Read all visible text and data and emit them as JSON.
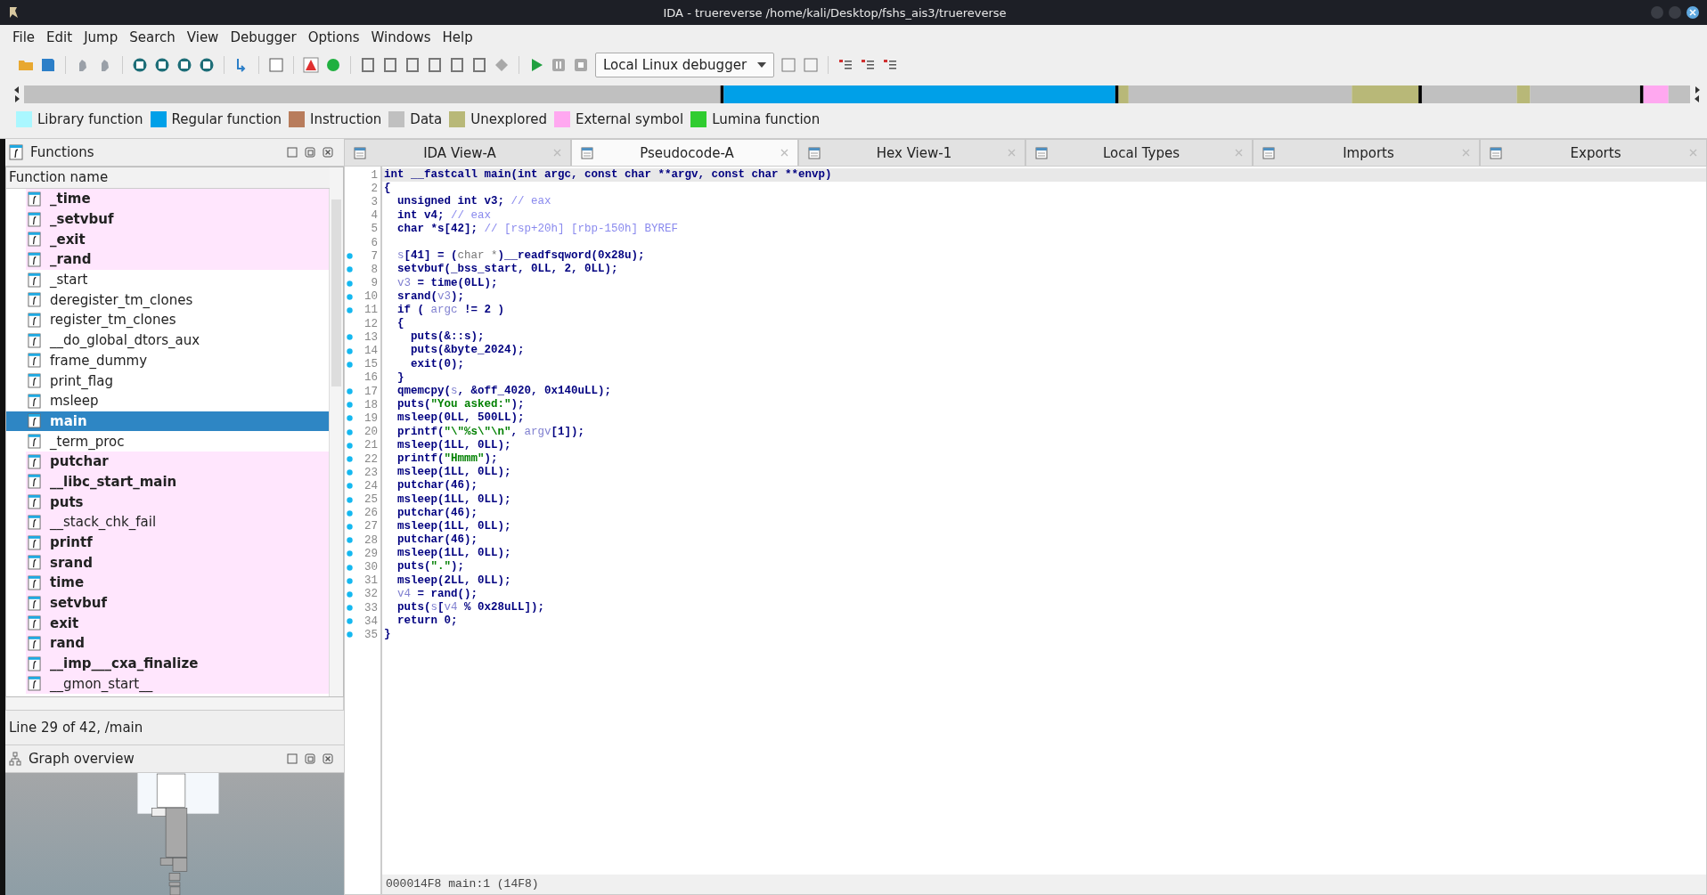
{
  "window": {
    "title": "IDA - truereverse /home/kali/Desktop/fshs_ais3/truereverse"
  },
  "menu": [
    "File",
    "Edit",
    "Jump",
    "Search",
    "View",
    "Debugger",
    "Options",
    "Windows",
    "Help"
  ],
  "toolbar": {
    "debugger": "Local Linux debugger"
  },
  "legend": [
    {
      "label": "Library function",
      "color": "#aaf7ff"
    },
    {
      "label": "Regular function",
      "color": "#00a0e8"
    },
    {
      "label": "Instruction",
      "color": "#b87c5c"
    },
    {
      "label": "Data",
      "color": "#c0c0c0"
    },
    {
      "label": "Unexplored",
      "color": "#b8b878"
    },
    {
      "label": "External symbol",
      "color": "#ffa8f0"
    },
    {
      "label": "Lumina function",
      "color": "#30cc30"
    }
  ],
  "functions": {
    "title": "Functions",
    "column": "Function name",
    "items": [
      {
        "name": "_time",
        "kind": "external",
        "selected": false
      },
      {
        "name": "_setvbuf",
        "kind": "external",
        "selected": false
      },
      {
        "name": "_exit",
        "kind": "external",
        "selected": false
      },
      {
        "name": "_rand",
        "kind": "external",
        "selected": false
      },
      {
        "name": "_start",
        "kind": "regular",
        "selected": false
      },
      {
        "name": "deregister_tm_clones",
        "kind": "regular",
        "selected": false
      },
      {
        "name": "register_tm_clones",
        "kind": "regular",
        "selected": false
      },
      {
        "name": "__do_global_dtors_aux",
        "kind": "regular",
        "selected": false
      },
      {
        "name": "frame_dummy",
        "kind": "regular",
        "selected": false
      },
      {
        "name": "print_flag",
        "kind": "regular",
        "selected": false
      },
      {
        "name": "msleep",
        "kind": "regular",
        "selected": false
      },
      {
        "name": "main",
        "kind": "regular",
        "selected": true
      },
      {
        "name": "_term_proc",
        "kind": "regular",
        "selected": false
      },
      {
        "name": "putchar",
        "kind": "external",
        "selected": false
      },
      {
        "name": "__libc_start_main",
        "kind": "external",
        "selected": false
      },
      {
        "name": "puts",
        "kind": "external",
        "selected": false
      },
      {
        "name": "__stack_chk_fail",
        "kind": "external_plain",
        "selected": false
      },
      {
        "name": "printf",
        "kind": "external",
        "selected": false
      },
      {
        "name": "srand",
        "kind": "external",
        "selected": false
      },
      {
        "name": "time",
        "kind": "external",
        "selected": false
      },
      {
        "name": "setvbuf",
        "kind": "external",
        "selected": false
      },
      {
        "name": "exit",
        "kind": "external",
        "selected": false
      },
      {
        "name": "rand",
        "kind": "external",
        "selected": false
      },
      {
        "name": "__imp___cxa_finalize",
        "kind": "external",
        "selected": false
      },
      {
        "name": "__gmon_start__",
        "kind": "external_plain",
        "selected": false
      }
    ]
  },
  "status": "Line 29 of 42, /main",
  "graph_overview": {
    "title": "Graph overview"
  },
  "tabs": [
    {
      "label": "IDA View-A",
      "selected": false
    },
    {
      "label": "Pseudocode-A",
      "selected": true
    },
    {
      "label": "Hex View-1",
      "selected": false
    },
    {
      "label": "Local Types",
      "selected": false
    },
    {
      "label": "Imports",
      "selected": false
    },
    {
      "label": "Exports",
      "selected": false
    }
  ],
  "code": [
    {
      "no": "1",
      "dot": false,
      "selected": true,
      "segs": [
        {
          "t": "int __fastcall main(int argc, const char **argv, const char **envp)",
          "kind": "n"
        }
      ]
    },
    {
      "no": "2",
      "dot": false,
      "selected": false,
      "segs": [
        {
          "t": "{",
          "kind": "n"
        }
      ]
    },
    {
      "no": "3",
      "dot": false,
      "selected": false,
      "segs": [
        {
          "t": "  unsigned int v3; ",
          "kind": "n"
        },
        {
          "t": "// eax",
          "kind": "c"
        }
      ]
    },
    {
      "no": "4",
      "dot": false,
      "selected": false,
      "segs": [
        {
          "t": "  int v4; ",
          "kind": "n"
        },
        {
          "t": "// eax",
          "kind": "c"
        }
      ]
    },
    {
      "no": "5",
      "dot": false,
      "selected": false,
      "segs": [
        {
          "t": "  char *s[42]; ",
          "kind": "n"
        },
        {
          "t": "// [rsp+20h] [rbp-150h] BYREF",
          "kind": "c"
        }
      ]
    },
    {
      "no": "6",
      "dot": false,
      "selected": false
    },
    {
      "no": "7",
      "dot": true,
      "selected": false,
      "segs": [
        {
          "t": "  s",
          "kind": "v"
        },
        {
          "t": "[41] = (",
          "kind": "n"
        },
        {
          "t": "char *",
          "kind": "g"
        },
        {
          "t": ")__readfsqword(0x28u);",
          "kind": "n"
        }
      ]
    },
    {
      "no": "8",
      "dot": true,
      "selected": false,
      "segs": [
        {
          "t": "  setvbuf(_bss_start, 0LL, 2, 0LL);",
          "kind": "n"
        }
      ]
    },
    {
      "no": "9",
      "dot": true,
      "selected": false,
      "segs": [
        {
          "t": "  v3",
          "kind": "v"
        },
        {
          "t": " = time(0LL);",
          "kind": "n"
        }
      ]
    },
    {
      "no": "10",
      "dot": true,
      "selected": false,
      "segs": [
        {
          "t": "  srand(",
          "kind": "n"
        },
        {
          "t": "v3",
          "kind": "v"
        },
        {
          "t": ");",
          "kind": "n"
        }
      ]
    },
    {
      "no": "11",
      "dot": true,
      "selected": false,
      "segs": [
        {
          "t": "  if ( ",
          "kind": "n"
        },
        {
          "t": "argc",
          "kind": "v"
        },
        {
          "t": " != 2 )",
          "kind": "n"
        }
      ]
    },
    {
      "no": "12",
      "dot": false,
      "selected": false,
      "segs": [
        {
          "t": "  {",
          "kind": "n"
        }
      ]
    },
    {
      "no": "13",
      "dot": true,
      "selected": false,
      "segs": [
        {
          "t": "    puts(&::s);",
          "kind": "n"
        }
      ]
    },
    {
      "no": "14",
      "dot": true,
      "selected": false,
      "segs": [
        {
          "t": "    puts(&byte_2024);",
          "kind": "n"
        }
      ]
    },
    {
      "no": "15",
      "dot": true,
      "selected": false,
      "segs": [
        {
          "t": "    exit(0);",
          "kind": "n"
        }
      ]
    },
    {
      "no": "16",
      "dot": false,
      "selected": false,
      "segs": [
        {
          "t": "  }",
          "kind": "n"
        }
      ]
    },
    {
      "no": "17",
      "dot": true,
      "selected": false,
      "segs": [
        {
          "t": "  qmemcpy(",
          "kind": "n"
        },
        {
          "t": "s",
          "kind": "v"
        },
        {
          "t": ", &off_4020, 0x140uLL);",
          "kind": "n"
        }
      ]
    },
    {
      "no": "18",
      "dot": true,
      "selected": false,
      "segs": [
        {
          "t": "  puts(",
          "kind": "n"
        },
        {
          "t": "\"You asked:\"",
          "kind": "s"
        },
        {
          "t": ");",
          "kind": "n"
        }
      ]
    },
    {
      "no": "19",
      "dot": true,
      "selected": false,
      "segs": [
        {
          "t": "  msleep(0LL, 500LL);",
          "kind": "n"
        }
      ]
    },
    {
      "no": "20",
      "dot": true,
      "selected": false,
      "segs": [
        {
          "t": "  printf(",
          "kind": "n"
        },
        {
          "t": "\"\\\"%s\\\"\\n\"",
          "kind": "s"
        },
        {
          "t": ", ",
          "kind": "n"
        },
        {
          "t": "argv",
          "kind": "v"
        },
        {
          "t": "[1]);",
          "kind": "n"
        }
      ]
    },
    {
      "no": "21",
      "dot": true,
      "selected": false,
      "segs": [
        {
          "t": "  msleep(1LL, 0LL);",
          "kind": "n"
        }
      ]
    },
    {
      "no": "22",
      "dot": true,
      "selected": false,
      "segs": [
        {
          "t": "  printf(",
          "kind": "n"
        },
        {
          "t": "\"Hmmm\"",
          "kind": "s"
        },
        {
          "t": ");",
          "kind": "n"
        }
      ]
    },
    {
      "no": "23",
      "dot": true,
      "selected": false,
      "segs": [
        {
          "t": "  msleep(1LL, 0LL);",
          "kind": "n"
        }
      ]
    },
    {
      "no": "24",
      "dot": true,
      "selected": false,
      "segs": [
        {
          "t": "  putchar(46);",
          "kind": "n"
        }
      ]
    },
    {
      "no": "25",
      "dot": true,
      "selected": false,
      "segs": [
        {
          "t": "  msleep(1LL, 0LL);",
          "kind": "n"
        }
      ]
    },
    {
      "no": "26",
      "dot": true,
      "selected": false,
      "segs": [
        {
          "t": "  putchar(46);",
          "kind": "n"
        }
      ]
    },
    {
      "no": "27",
      "dot": true,
      "selected": false,
      "segs": [
        {
          "t": "  msleep(1LL, 0LL);",
          "kind": "n"
        }
      ]
    },
    {
      "no": "28",
      "dot": true,
      "selected": false,
      "segs": [
        {
          "t": "  putchar(46);",
          "kind": "n"
        }
      ]
    },
    {
      "no": "29",
      "dot": true,
      "selected": false,
      "segs": [
        {
          "t": "  msleep(1LL, 0LL);",
          "kind": "n"
        }
      ]
    },
    {
      "no": "30",
      "dot": true,
      "selected": false,
      "segs": [
        {
          "t": "  puts(",
          "kind": "n"
        },
        {
          "t": "\".\"",
          "kind": "s"
        },
        {
          "t": ");",
          "kind": "n"
        }
      ]
    },
    {
      "no": "31",
      "dot": true,
      "selected": false,
      "segs": [
        {
          "t": "  msleep(2LL, 0LL);",
          "kind": "n"
        }
      ]
    },
    {
      "no": "32",
      "dot": true,
      "selected": false,
      "segs": [
        {
          "t": "  v4",
          "kind": "v"
        },
        {
          "t": " = rand();",
          "kind": "n"
        }
      ]
    },
    {
      "no": "33",
      "dot": true,
      "selected": false,
      "segs": [
        {
          "t": "  puts(",
          "kind": "n"
        },
        {
          "t": "s",
          "kind": "v"
        },
        {
          "t": "[",
          "kind": "n"
        },
        {
          "t": "v4",
          "kind": "v"
        },
        {
          "t": " % 0x28uLL]);",
          "kind": "n"
        }
      ]
    },
    {
      "no": "34",
      "dot": true,
      "selected": false,
      "segs": [
        {
          "t": "  return 0;",
          "kind": "n"
        }
      ]
    },
    {
      "no": "35",
      "dot": true,
      "selected": false,
      "segs": [
        {
          "t": "}",
          "kind": "n"
        }
      ]
    }
  ],
  "code_status": "000014F8 main:1 (14F8)"
}
